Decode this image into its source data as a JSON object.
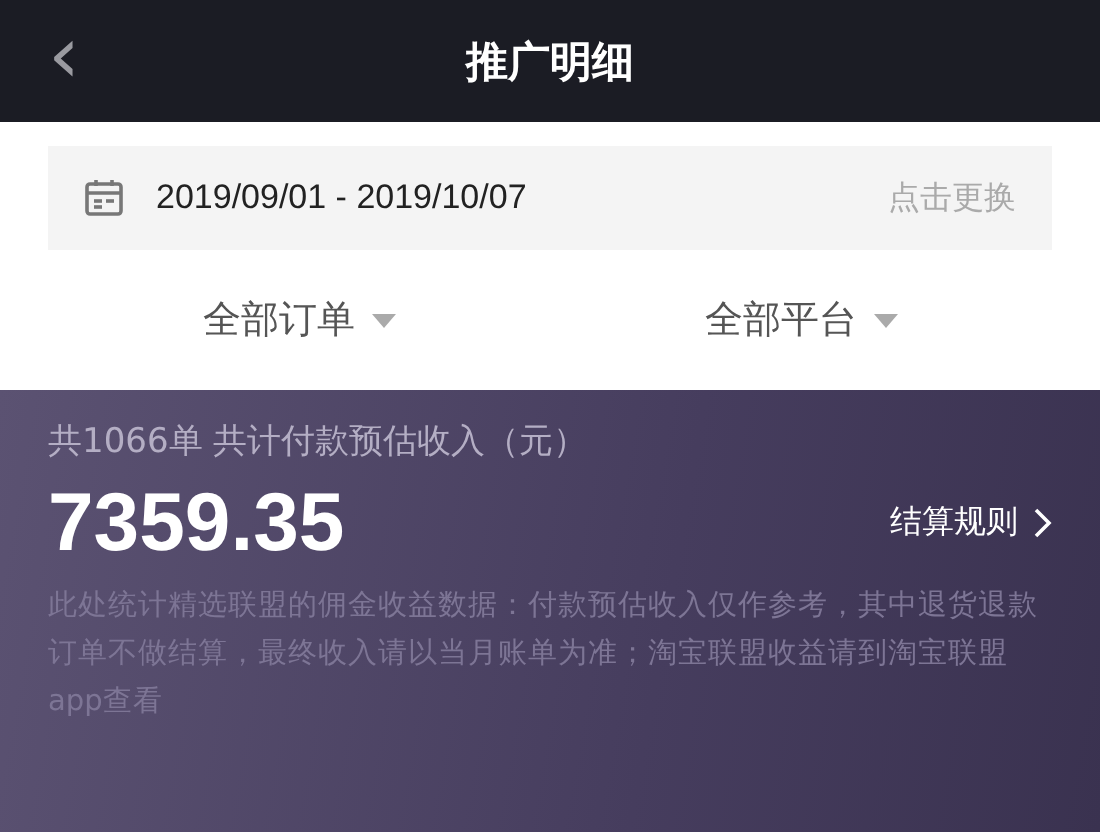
{
  "header": {
    "back": "‹",
    "title": "推广明细"
  },
  "date_range": {
    "value": "2019/09/01 - 2019/10/07",
    "action": "点击更换"
  },
  "filters": [
    {
      "label": "全部订单"
    },
    {
      "label": "全部平台"
    }
  ],
  "summary": {
    "caption": "共1066单 共计付款预估收入（元）",
    "amount": "7359.35",
    "rules_link": "结算规则",
    "note": "此处统计精选联盟的佣金收益数据：付款预估收入仅作参考，其中退货退款订单不做结算，最终收入请以当月账单为准；淘宝联盟收益请到淘宝联盟app查看"
  }
}
